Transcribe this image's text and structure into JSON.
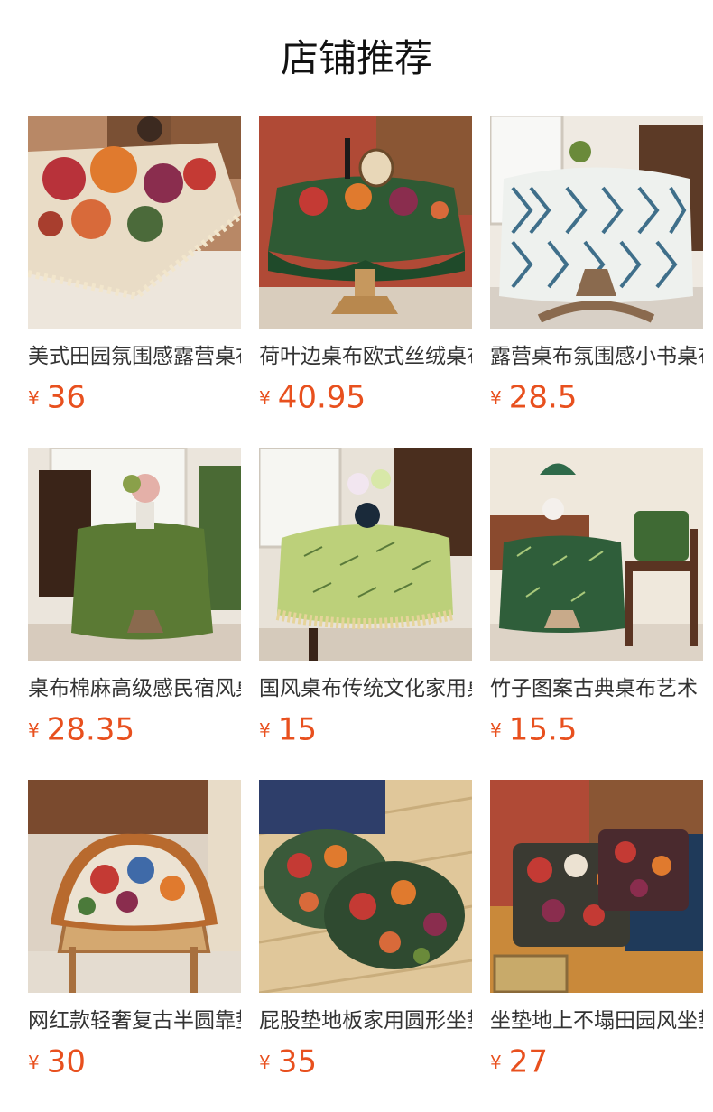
{
  "section": {
    "title": "店铺推荐"
  },
  "products": [
    {
      "name": "美式田园氛围感露营桌布",
      "currency": "¥",
      "price": "36",
      "image": "floral-tapestry-tablecloth-with-tassels"
    },
    {
      "name": "荷叶边桌布欧式丝绒桌布",
      "currency": "¥",
      "price": "40.95",
      "image": "green-velvet-ruffle-floral-tablecloth"
    },
    {
      "name": "露营桌布氛围感小书桌布",
      "currency": "¥",
      "price": "28.5",
      "image": "blue-diamond-pattern-tablecloth"
    },
    {
      "name": "桌布棉麻高级感民宿风桌布",
      "currency": "¥",
      "price": "28.35",
      "image": "green-linen-round-tablecloth"
    },
    {
      "name": "国风桌布传统文化家用桌布",
      "currency": "¥",
      "price": "15",
      "image": "light-green-bamboo-print-tablecloth"
    },
    {
      "name": "竹子图案古典桌布艺术",
      "currency": "¥",
      "price": "15.5",
      "image": "dark-green-bamboo-tablecloth"
    },
    {
      "name": "网红款轻奢复古半圆靠垫",
      "currency": "¥",
      "price": "30",
      "image": "half-round-ruffle-floral-cushion"
    },
    {
      "name": "屁股垫地板家用圆形坐垫",
      "currency": "¥",
      "price": "35",
      "image": "round-floral-floor-cushions"
    },
    {
      "name": "坐垫地上不塌田园风坐垫",
      "currency": "¥",
      "price": "27",
      "image": "square-floral-seat-cushions"
    }
  ]
}
